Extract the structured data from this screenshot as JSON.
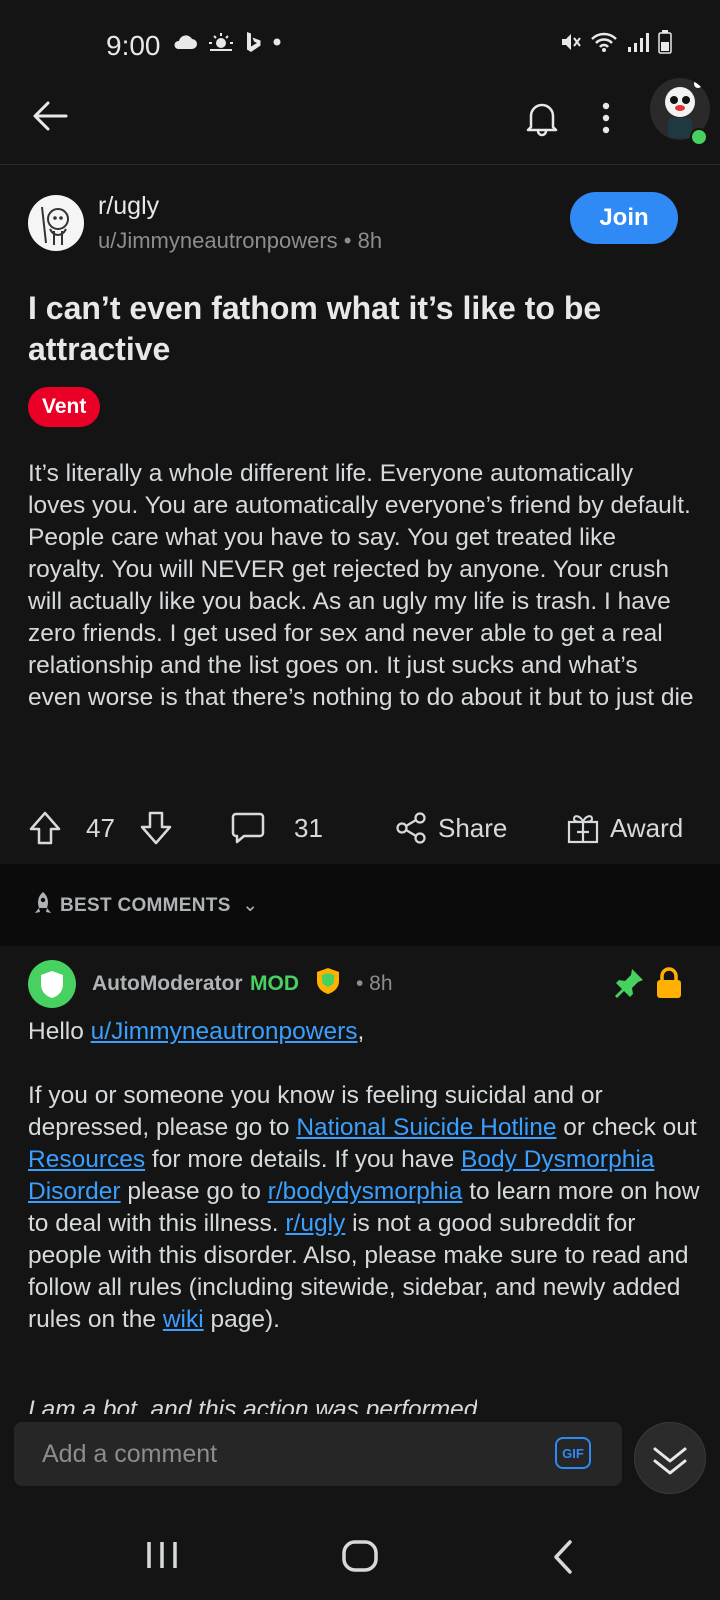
{
  "status_bar": {
    "time": "9:00",
    "icons_left": [
      "cloud-icon",
      "weather-sun-icon",
      "bing-icon",
      "dot-icon"
    ],
    "icons_right": [
      "mute-icon",
      "wifi-icon",
      "signal-icon",
      "battery-icon"
    ]
  },
  "header": {
    "back_icon": "back-arrow-icon",
    "bell_icon": "bell-icon",
    "menu_icon": "kebab-menu-icon"
  },
  "post": {
    "subreddit": "r/ugly",
    "author_line": "u/Jimmyneautronpowers • 8h",
    "join_label": "Join",
    "title": "I can’t even fathom what it’s like to be attractive",
    "flair": "Vent",
    "body": "It’s literally a whole different life. Everyone automatically loves you. You are automatically everyone’s friend by default. People care what you have to say. You get treated like royalty. You will NEVER get rejected by anyone. Your crush will actually like you back. As an ugly my life is trash. I have zero friends. I get used for sex and never able to get a real relationship and the list goes on. It just sucks and what’s even worse is that there’s nothing to do about it but to just die",
    "upvotes": "47",
    "comments": "31",
    "share_label": "Share",
    "award_label": "Award"
  },
  "sort": {
    "label": "BEST COMMENTS"
  },
  "comment": {
    "author": "AutoModerator",
    "mod_badge": "MOD",
    "time": "• 8h",
    "greeting_prefix": "Hello ",
    "greeting_link": "u/Jimmyneautronpowers",
    "greeting_suffix": ",",
    "p2_a": "If you or someone you know is feeling suicidal and or depressed, please go to ",
    "p2_link1": "National Suicide Hotline",
    "p2_b": " or check out ",
    "p2_link2": "Resources",
    "p2_c": " for more details. If you have ",
    "p2_link3": "Body Dysmorphia Disorder",
    "p2_d": " please go to ",
    "p2_link4": "r/bodydysmorphia",
    "p2_e": " to learn more on how to deal with this illness. ",
    "p2_link5": "r/ugly",
    "p2_f": " is not a good subreddit for people with this disorder. Also, please make sure to read and follow all rules (including sitewide, sidebar, and newly added rules on the ",
    "p2_link6": "wiki",
    "p2_g": " page).",
    "bot_line": "I am a bot, and this action was performed"
  },
  "composer": {
    "placeholder": "Add a comment",
    "gif_label": "GIF"
  },
  "colors": {
    "background": "#141414",
    "accent": "#2f8af5",
    "flair": "#ea0027",
    "mod": "#46d160",
    "link": "#3aa0ff",
    "pin": "#46d160",
    "lock": "#ffb000"
  }
}
